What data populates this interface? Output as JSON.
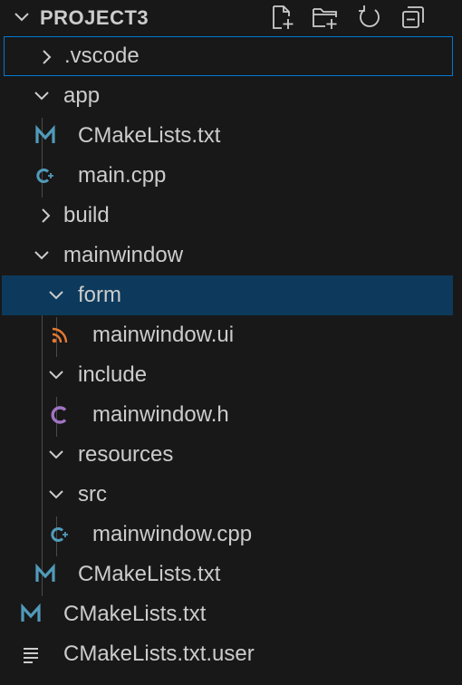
{
  "explorer": {
    "title": "PROJECT3",
    "actions": [
      {
        "name": "new-file-icon"
      },
      {
        "name": "new-folder-icon"
      },
      {
        "name": "refresh-icon"
      },
      {
        "name": "collapse-all-icon"
      }
    ]
  },
  "tree": [
    {
      "label": ".vscode",
      "type": "folder",
      "expanded": false,
      "state": "focused"
    },
    {
      "label": "app",
      "type": "folder",
      "expanded": true
    },
    {
      "label": "CMakeLists.txt",
      "type": "file",
      "icon": "cmake-icon"
    },
    {
      "label": "main.cpp",
      "type": "file",
      "icon": "cpp-icon"
    },
    {
      "label": "build",
      "type": "folder",
      "expanded": false
    },
    {
      "label": "mainwindow",
      "type": "folder",
      "expanded": true
    },
    {
      "label": "form",
      "type": "folder",
      "expanded": true,
      "state": "selected"
    },
    {
      "label": "mainwindow.ui",
      "type": "file",
      "icon": "rss-icon"
    },
    {
      "label": "include",
      "type": "folder",
      "expanded": true
    },
    {
      "label": "mainwindow.h",
      "type": "file",
      "icon": "c-header-icon"
    },
    {
      "label": "resources",
      "type": "folder",
      "expanded": true
    },
    {
      "label": "src",
      "type": "folder",
      "expanded": true
    },
    {
      "label": "mainwindow.cpp",
      "type": "file",
      "icon": "cpp-icon"
    },
    {
      "label": "CMakeLists.txt",
      "type": "file",
      "icon": "cmake-icon"
    },
    {
      "label": "CMakeLists.txt",
      "type": "file",
      "icon": "cmake-icon"
    },
    {
      "label": "CMakeLists.txt.user",
      "type": "file",
      "icon": "text-file-icon"
    }
  ],
  "colors": {
    "background": "#181818",
    "text": "#cccccc",
    "focus_border": "#0078d4",
    "selection": "#0d3a5c",
    "cmake_icon": "#519aba",
    "cpp_icon": "#519aba",
    "c_header_icon": "#a074c4",
    "rss_icon": "#e37933"
  }
}
